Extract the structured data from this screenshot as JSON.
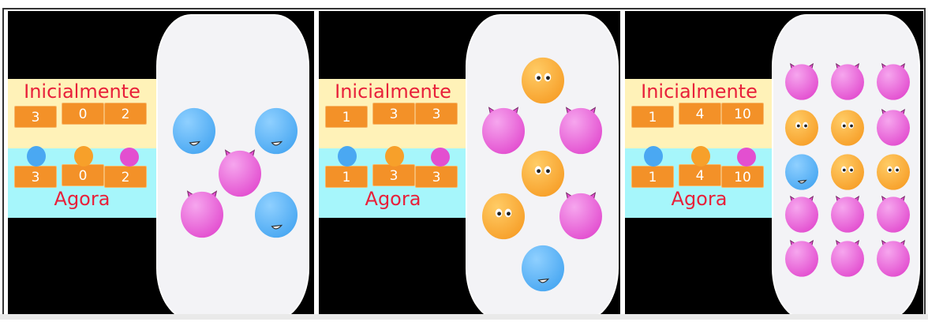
{
  "colors": {
    "blue": "#4aa8f2",
    "orange": "#f7a02a",
    "pink": "#e34fd0",
    "title_red": "#e8203a",
    "num_orange": "#f39128"
  },
  "panels": [
    {
      "initial_label": "Inicialmente",
      "now_label": "Agora",
      "initial_values": [
        "3",
        "0",
        "2"
      ],
      "now_values": [
        "3",
        "0",
        "2"
      ],
      "creatures": [
        "blue",
        "blue",
        "pink",
        "pink",
        "blue"
      ]
    },
    {
      "initial_label": "Inicialmente",
      "now_label": "Agora",
      "initial_values": [
        "1",
        "3",
        "3"
      ],
      "now_values": [
        "1",
        "3",
        "3"
      ],
      "creatures": [
        "orange",
        "pink",
        "pink",
        "orange",
        "orange",
        "pink",
        "blue"
      ]
    },
    {
      "initial_label": "Inicialmente",
      "now_label": "Agora",
      "initial_values": [
        "1",
        "4",
        "10"
      ],
      "now_values": [
        "1",
        "4",
        "10"
      ],
      "creatures": [
        "pink",
        "pink",
        "pink",
        "orange",
        "orange",
        "pink",
        "blue",
        "orange",
        "orange",
        "pink",
        "pink",
        "pink",
        "pink",
        "pink",
        "pink"
      ]
    }
  ]
}
